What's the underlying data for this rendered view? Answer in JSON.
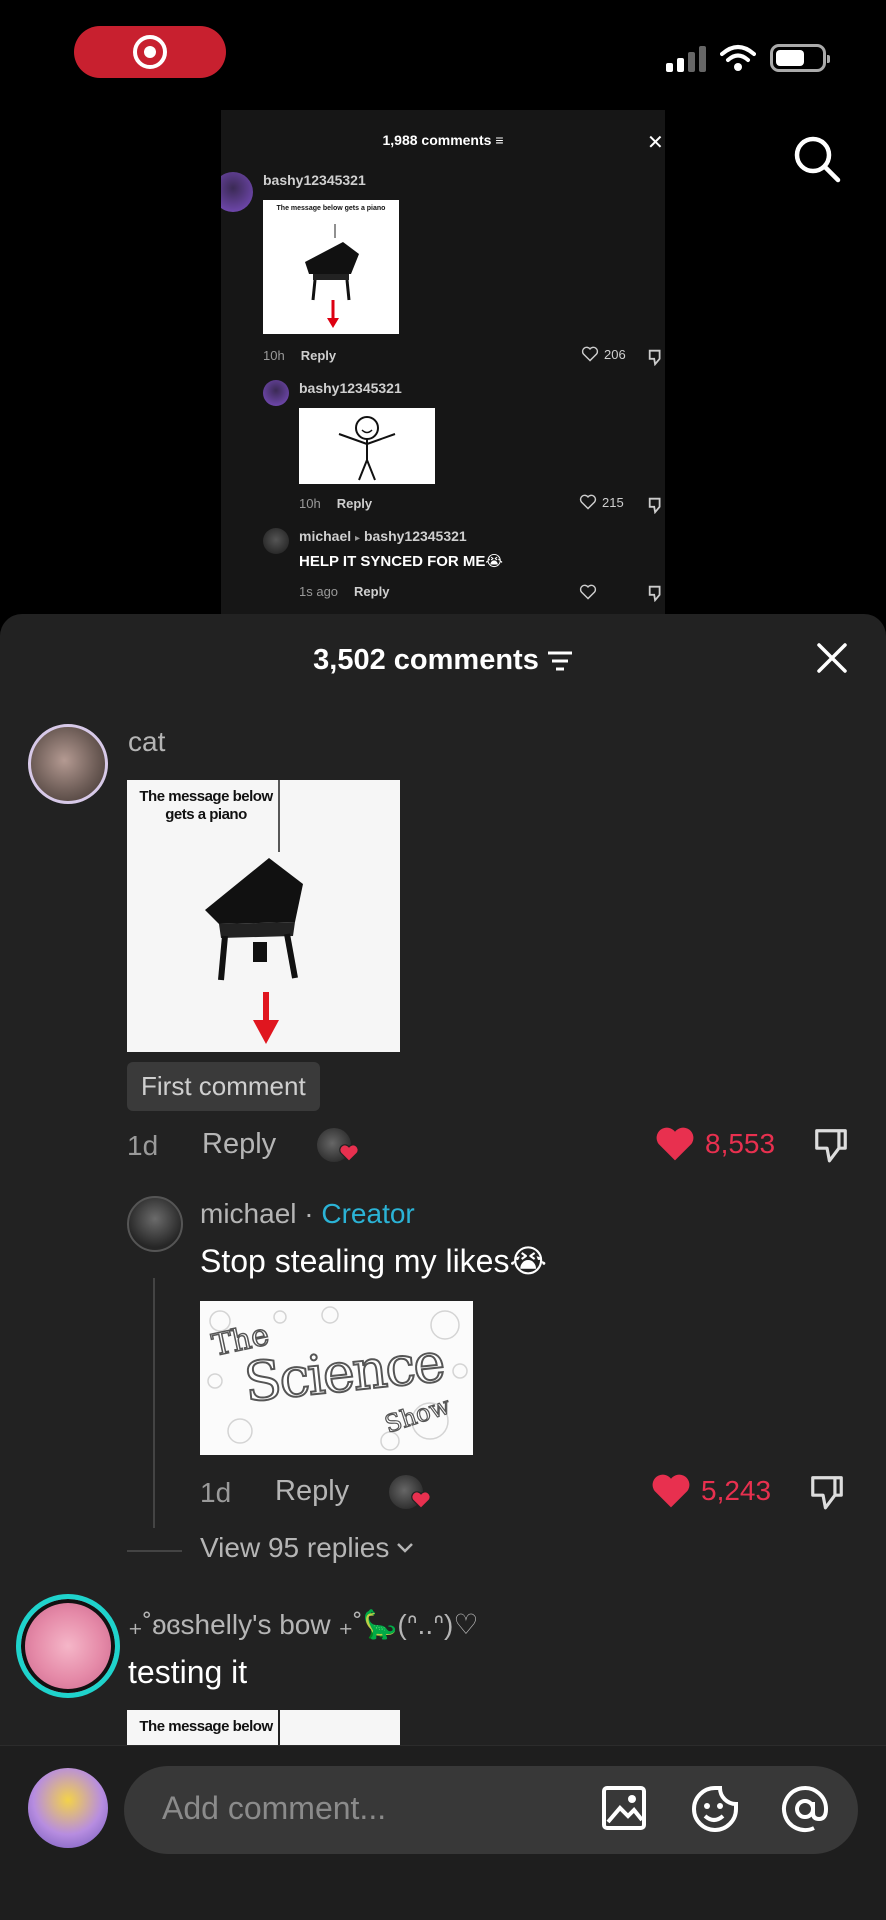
{
  "status": {
    "recording": true
  },
  "inner": {
    "title": "1,988 comments",
    "comments": [
      {
        "user": "bashy12345321",
        "time": "10h",
        "reply": "Reply",
        "likes": "206",
        "img_text": "The message below gets a piano"
      },
      {
        "user": "bashy12345321",
        "time": "10h",
        "reply": "Reply",
        "likes": "215"
      },
      {
        "user": "michael",
        "reply_to": "bashy12345321",
        "text": "HELP IT SYNCED FOR ME😭",
        "time": "1s ago",
        "reply": "Reply"
      }
    ]
  },
  "sheet": {
    "title": "3,502 comments",
    "comments": [
      {
        "user": "cat",
        "image_text": "The message below gets a piano",
        "badge": "First comment",
        "time": "1d",
        "reply": "Reply",
        "likes": "8,553"
      },
      {
        "user": "michael",
        "separator": "·",
        "creator": "Creator",
        "text": "Stop stealing my likes😭",
        "image_text_1": "The",
        "image_text_2": "Science",
        "image_text_3": "Show",
        "time": "1d",
        "reply": "Reply",
        "likes": "5,243"
      },
      {
        "user": "₊˚ʚɞshelly's bow ₊˚🦕(ᐢ..ᐢ)♡",
        "text": "testing it",
        "image_text": "The message below"
      }
    ],
    "view_replies": "View 95 replies"
  },
  "composer": {
    "placeholder": "Add comment..."
  },
  "colors": {
    "like": "#e8304f",
    "creator": "#2bb3d6",
    "record": "#c8202f"
  }
}
